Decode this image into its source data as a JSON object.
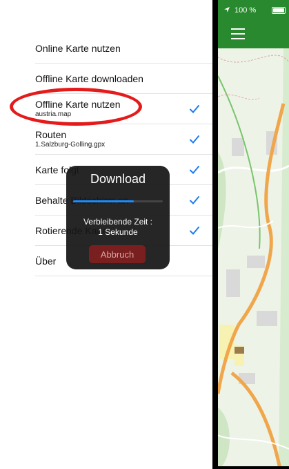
{
  "menu": {
    "items": [
      {
        "label": "Online Karte nutzen",
        "sub": "",
        "checked": false
      },
      {
        "label": "Offline Karte downloaden",
        "sub": "",
        "checked": false
      },
      {
        "label": "Offline Karte nutzen",
        "sub": "austria.map",
        "checked": true
      },
      {
        "label": "Routen",
        "sub": "1.Salzburg-Golling.gpx",
        "checked": true
      },
      {
        "label": "Karte folgt",
        "sub": "",
        "checked": true
      },
      {
        "label": "Behalte Bildschirm an",
        "sub": "",
        "checked": true
      },
      {
        "label": "Rotierende Karte",
        "sub": "",
        "checked": true
      },
      {
        "label": "Über",
        "sub": "",
        "checked": false
      }
    ],
    "check_icon": "checkmark-icon",
    "check_color": "#1a7cf5"
  },
  "highlight": {
    "color": "#e31b1b",
    "target": "Offline Karte nutzen"
  },
  "download_hud": {
    "title": "Download",
    "progress": 0.68,
    "remaining_text": "Verbleibende Zeit :\n1 Sekunde",
    "cancel_label": "Abbruch",
    "progress_color": "#1a8cff",
    "cancel_color": "#7a1f1f"
  },
  "map_panel": {
    "status": {
      "battery_percent": "100 %",
      "location_icon": "location-arrow-icon",
      "battery_icon": "battery-icon"
    },
    "nav": {
      "menu_icon": "hamburger-icon"
    },
    "header_color": "#28892e"
  }
}
